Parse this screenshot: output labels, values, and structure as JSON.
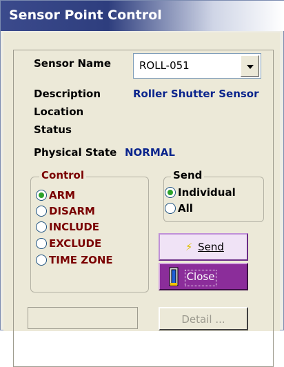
{
  "window": {
    "title": "Sensor Point Control"
  },
  "sensor_name": {
    "label": "Sensor Name",
    "value": "ROLL-051"
  },
  "description": {
    "label": "Description",
    "value": "Roller Shutter Sensor"
  },
  "location": {
    "label": "Location",
    "value": ""
  },
  "status": {
    "label": "Status",
    "value": ""
  },
  "physical_state": {
    "label": "Physical State",
    "value": "NORMAL"
  },
  "control": {
    "legend": "Control",
    "options": [
      {
        "label": "ARM",
        "selected": true
      },
      {
        "label": "DISARM",
        "selected": false
      },
      {
        "label": "INCLUDE",
        "selected": false
      },
      {
        "label": "EXCLUDE",
        "selected": false
      },
      {
        "label": "TIME ZONE",
        "selected": false
      }
    ]
  },
  "send_mode": {
    "legend": "Send",
    "options": [
      {
        "label": "Individual",
        "selected": true
      },
      {
        "label": "All",
        "selected": false
      }
    ]
  },
  "buttons": {
    "send": "Send",
    "close": "Close",
    "detail": "Detail ..."
  },
  "colors": {
    "control_text": "#7a0000",
    "value_blue": "#0a248c"
  }
}
